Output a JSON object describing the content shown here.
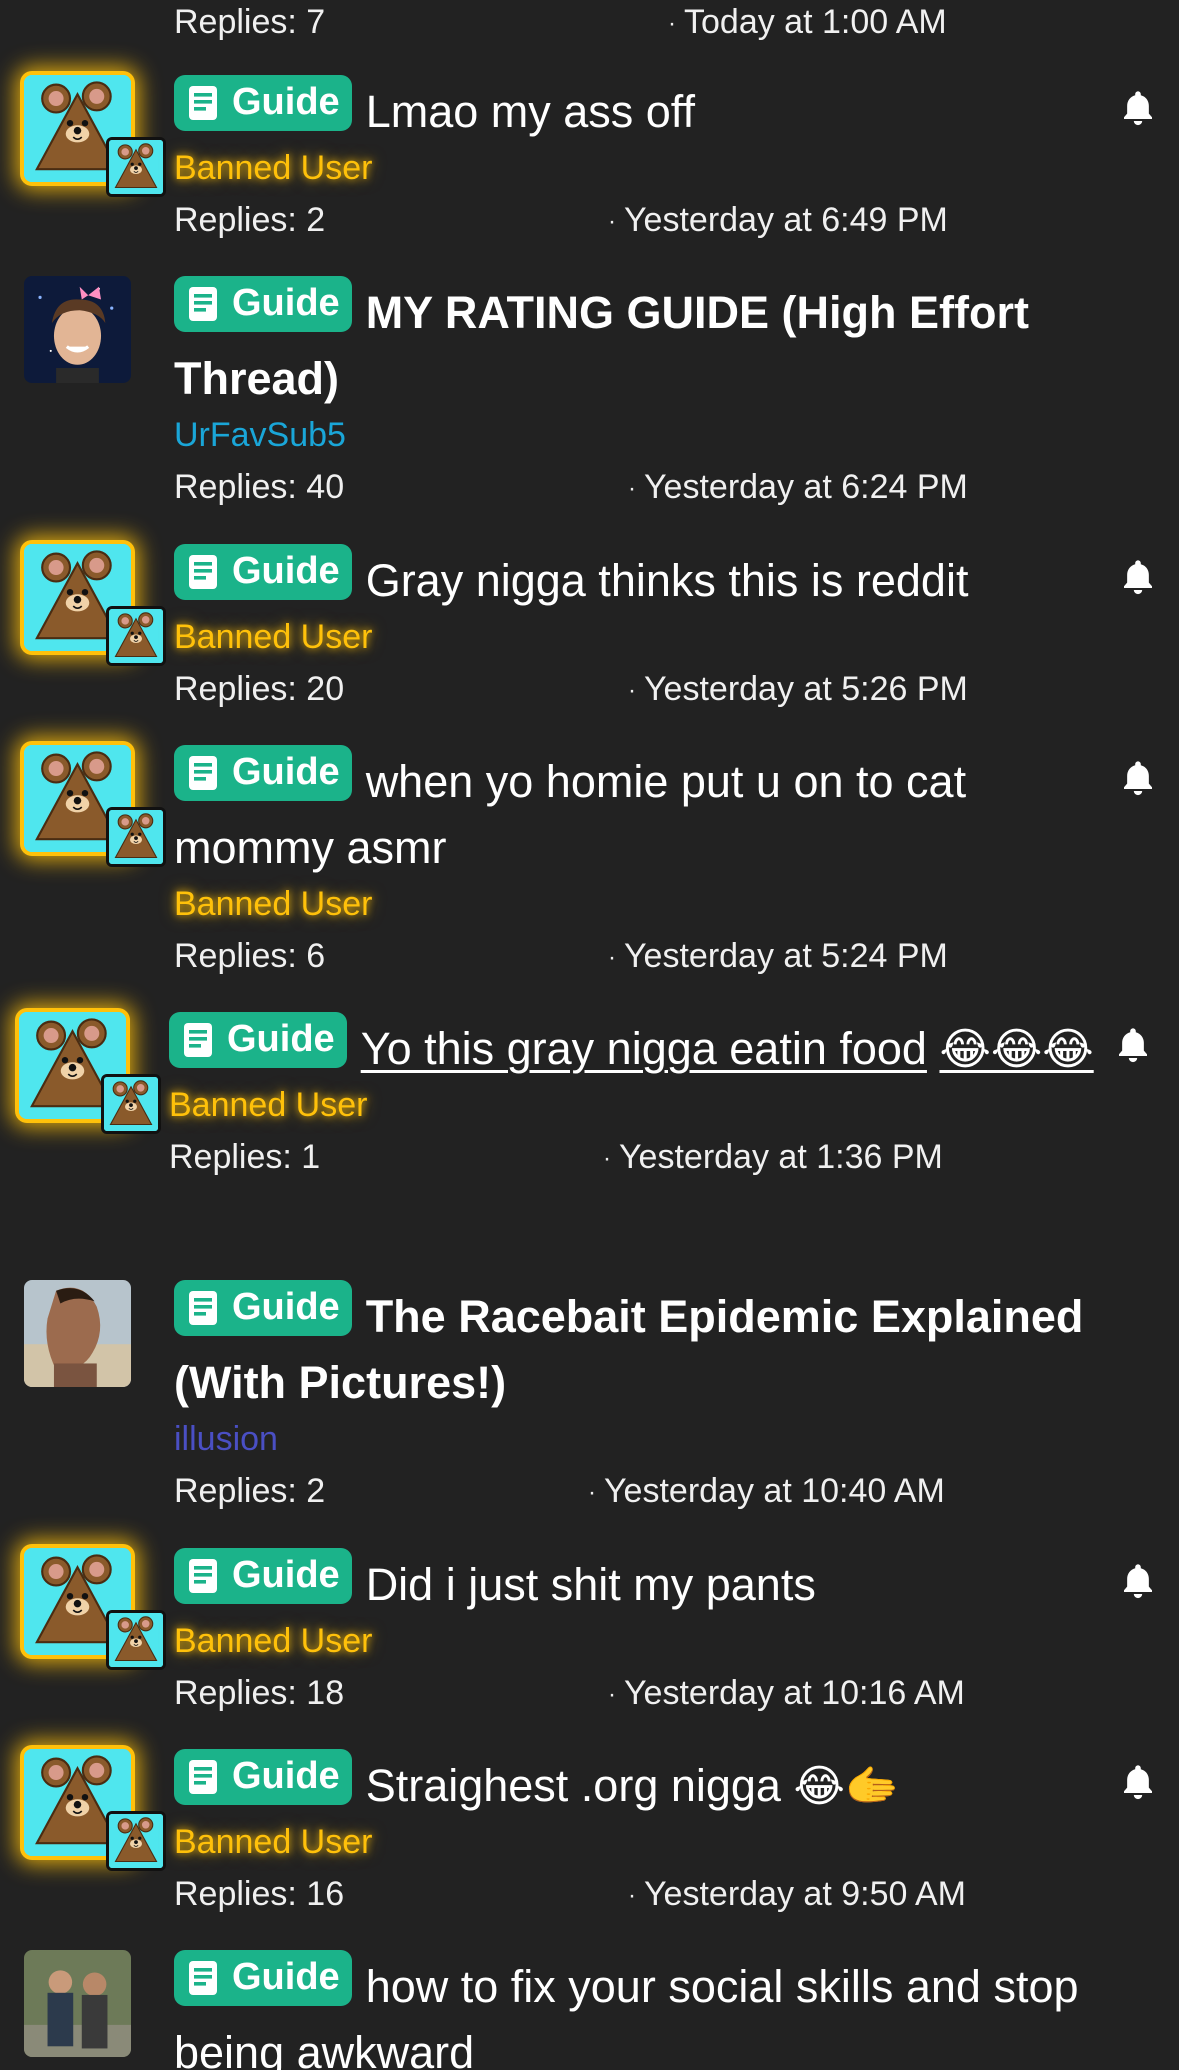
{
  "prefix_label": "Guide",
  "colors": {
    "background": "#222222",
    "prefix_bg": "#1bb38a",
    "banned": "#ffc10a",
    "accent_cyan": "#1aa6d8",
    "accent_indigo": "#4a4fc4"
  },
  "icons": {
    "prefix": "document-icon",
    "watch": "bell-icon"
  },
  "header": {
    "replies": "Replies: 7",
    "date": "Today at 1:00 AM"
  },
  "threads": [
    {
      "title": "Lmao my ass off",
      "title_emoji": "",
      "author": "Banned User",
      "author_style": "banned",
      "replies": "Replies: 2",
      "date": "Yesterday at 6:49 PM",
      "watched": true,
      "bold": false,
      "underline": false,
      "avatar": "banned-bear"
    },
    {
      "title": "MY RATING GUIDE (High Effort Thread)",
      "title_emoji": "",
      "author": "UrFavSub5",
      "author_style": "cyan",
      "replies": "Replies: 40",
      "date": "Yesterday at 6:24 PM",
      "watched": false,
      "bold": true,
      "underline": false,
      "avatar": "photo-boy"
    },
    {
      "title": "Gray nigga thinks this is reddit",
      "title_emoji": "",
      "author": "Banned User",
      "author_style": "banned",
      "replies": "Replies: 20",
      "date": "Yesterday at 5:26 PM",
      "watched": true,
      "bold": false,
      "underline": false,
      "avatar": "banned-bear"
    },
    {
      "title": "when yo homie put u on to cat mommy asmr",
      "title_emoji": "",
      "author": "Banned User",
      "author_style": "banned",
      "replies": "Replies: 6",
      "date": "Yesterday at 5:24 PM",
      "watched": true,
      "bold": false,
      "underline": false,
      "avatar": "banned-bear"
    },
    {
      "title": "Yo this gray nigga eatin food",
      "title_emoji": "😂😂😂",
      "author": "Banned User",
      "author_style": "banned",
      "replies": "Replies: 1",
      "date": "Yesterday at 1:36 PM",
      "watched": true,
      "bold": false,
      "underline": true,
      "avatar": "banned-bear"
    },
    {
      "title": "The Racebait Epidemic Explained (With Pictures!)",
      "title_emoji": "",
      "author": "illusion",
      "author_style": "indigo",
      "replies": "Replies: 2",
      "date": "Yesterday at 10:40 AM",
      "watched": false,
      "bold": true,
      "underline": false,
      "avatar": "photo-profile"
    },
    {
      "title": "Did i just shit my pants",
      "title_emoji": "",
      "author": "Banned User",
      "author_style": "banned",
      "replies": "Replies: 18",
      "date": "Yesterday at 10:16 AM",
      "watched": true,
      "bold": false,
      "underline": false,
      "avatar": "banned-bear"
    },
    {
      "title": "Straighest .org nigga",
      "title_emoji": "😂🫱",
      "author": "Banned User",
      "author_style": "banned",
      "replies": "Replies: 16",
      "date": "Yesterday at 9:50 AM",
      "watched": true,
      "bold": false,
      "underline": false,
      "avatar": "banned-bear"
    },
    {
      "title": "how to fix your social skills and stop being awkward",
      "title_emoji": "",
      "author": "",
      "author_style": "none",
      "replies": "",
      "date": "",
      "watched": false,
      "bold": false,
      "underline": false,
      "avatar": "photo-group"
    }
  ]
}
